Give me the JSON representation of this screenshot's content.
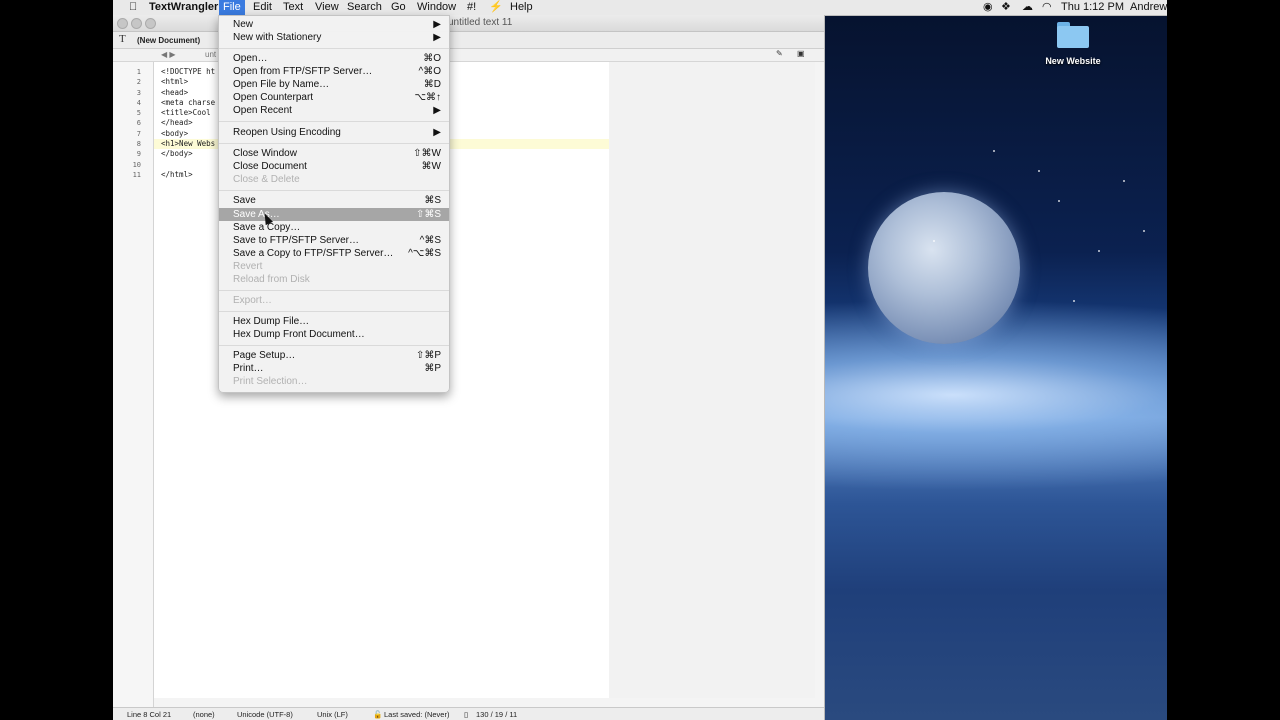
{
  "menubar": {
    "apple": "",
    "items": [
      "TextWrangler",
      "File",
      "Edit",
      "Text",
      "View",
      "Search",
      "Go",
      "Window",
      "#!",
      "⚡",
      "Help"
    ],
    "clock": "Thu 1:12 PM",
    "user": "Andrew"
  },
  "desktop": {
    "folder_label": "New Website"
  },
  "window": {
    "title": "untitled text 11",
    "doc_name": "(New Document)",
    "nav_left": "◀ ▶",
    "nav_name": "unt",
    "toolbar_icon": "T"
  },
  "editor": {
    "line_numbers": [
      "1",
      "2",
      "3",
      "4",
      "5",
      "6",
      "7",
      "8",
      "9",
      "10",
      "11"
    ],
    "lines": [
      "<!DOCTYPE ht",
      "<html>",
      "<head>",
      "<meta charse",
      "<title>Cool",
      "</head>",
      "<body>",
      "<h1>New Webs",
      "</body>",
      "",
      "</html>"
    ]
  },
  "filemenu": {
    "new": {
      "label": "New",
      "shortcut": "▶"
    },
    "new_stationery": {
      "label": "New with Stationery",
      "shortcut": "▶"
    },
    "open": {
      "label": "Open…",
      "shortcut": "⌘O"
    },
    "open_ftp": {
      "label": "Open from FTP/SFTP Server…",
      "shortcut": "^⌘O"
    },
    "open_by_name": {
      "label": "Open File by Name…",
      "shortcut": "⌘D"
    },
    "open_counterpart": {
      "label": "Open Counterpart",
      "shortcut": "⌥⌘↑"
    },
    "open_recent": {
      "label": "Open Recent",
      "shortcut": "▶"
    },
    "reopen_encoding": {
      "label": "Reopen Using Encoding",
      "shortcut": "▶"
    },
    "close_window": {
      "label": "Close Window",
      "shortcut": "⇧⌘W"
    },
    "close_document": {
      "label": "Close Document",
      "shortcut": "⌘W"
    },
    "close_delete": {
      "label": "Close & Delete",
      "shortcut": ""
    },
    "save": {
      "label": "Save",
      "shortcut": "⌘S"
    },
    "save_as": {
      "label": "Save As…",
      "shortcut": "⇧⌘S"
    },
    "save_copy": {
      "label": "Save a Copy…",
      "shortcut": ""
    },
    "save_ftp": {
      "label": "Save to FTP/SFTP Server…",
      "shortcut": "^⌘S"
    },
    "save_copy_ftp": {
      "label": "Save a Copy to FTP/SFTP Server…",
      "shortcut": "^⌥⌘S"
    },
    "revert": {
      "label": "Revert",
      "shortcut": ""
    },
    "reload": {
      "label": "Reload from Disk",
      "shortcut": ""
    },
    "export": {
      "label": "Export…",
      "shortcut": ""
    },
    "hex_dump_file": {
      "label": "Hex Dump File…",
      "shortcut": ""
    },
    "hex_dump_front": {
      "label": "Hex Dump Front Document…",
      "shortcut": ""
    },
    "page_setup": {
      "label": "Page Setup…",
      "shortcut": "⇧⌘P"
    },
    "print": {
      "label": "Print…",
      "shortcut": "⌘P"
    },
    "print_selection": {
      "label": "Print Selection…",
      "shortcut": ""
    }
  },
  "statusbar": {
    "position": "Line 8 Col 21",
    "language": "(none)",
    "encoding": "Unicode (UTF-8)",
    "line_endings": "Unix (LF)",
    "last_saved": "Last saved: (Never)",
    "counts": "130 / 19 / 11"
  }
}
